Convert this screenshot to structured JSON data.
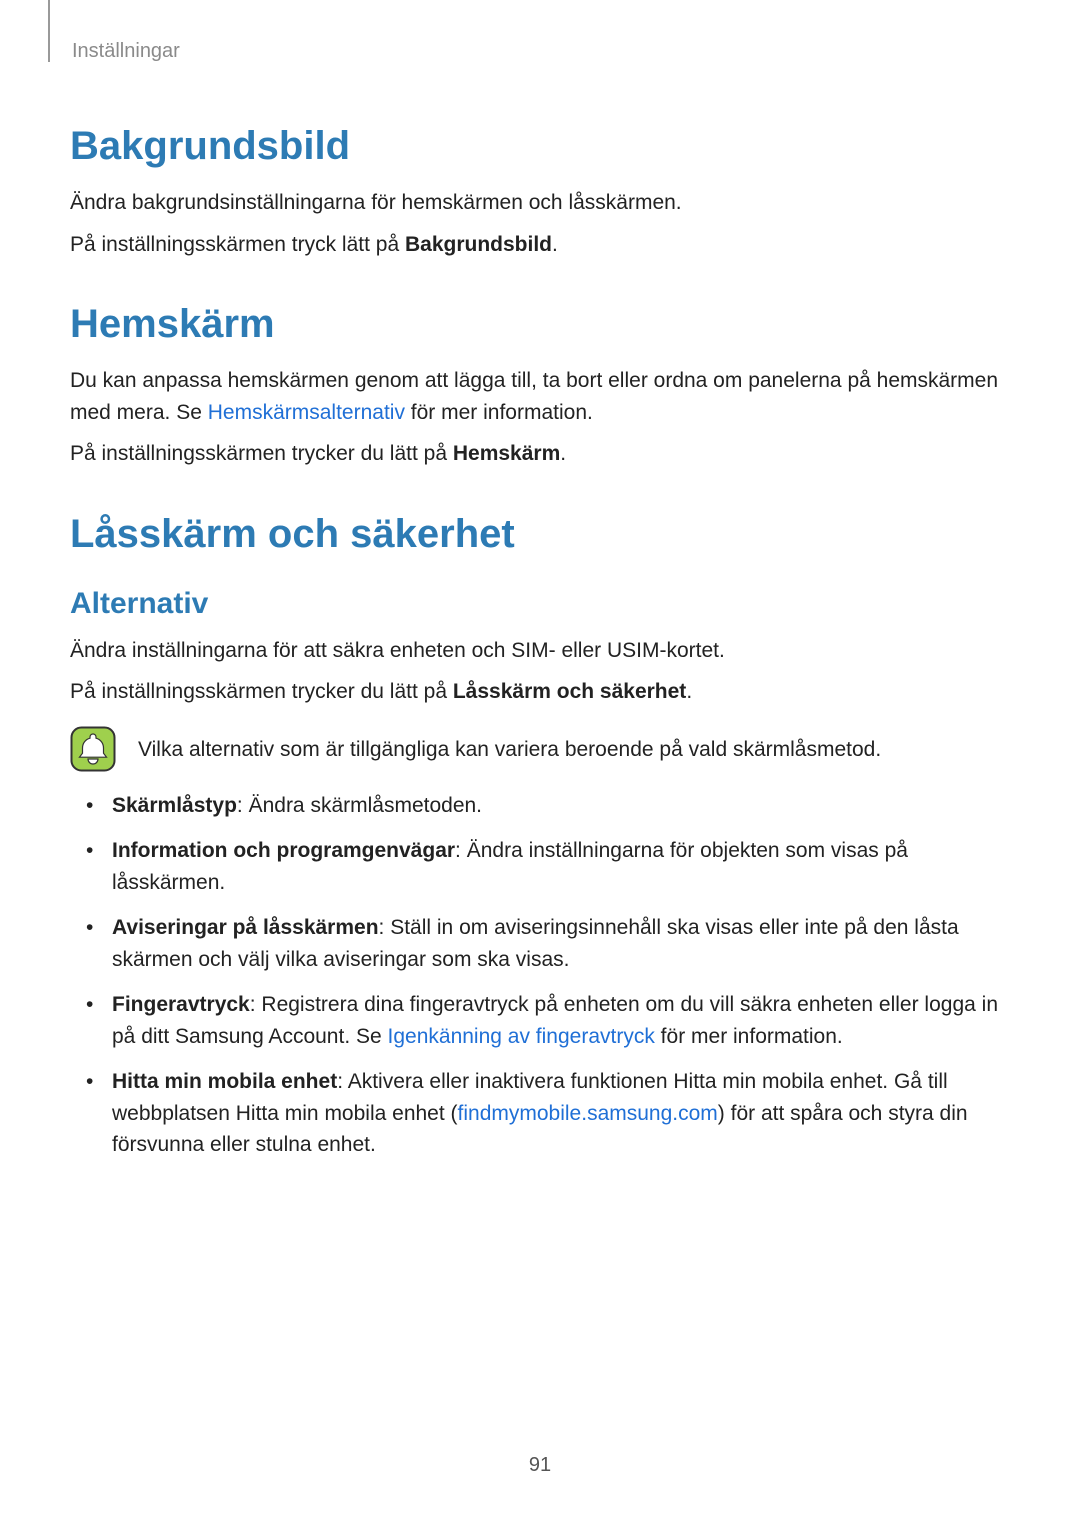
{
  "breadcrumb": "Inställningar",
  "page_number": "91",
  "sec_bakgrund": {
    "title": "Bakgrundsbild",
    "p1": "Ändra bakgrundsinställningarna för hemskärmen och låsskärmen.",
    "p2a": "På inställningsskärmen tryck lätt på ",
    "p2b": "Bakgrundsbild",
    "p2c": "."
  },
  "sec_hemskarm": {
    "title": "Hemskärm",
    "p1a": "Du kan anpassa hemskärmen genom att lägga till, ta bort eller ordna om panelerna på hemskärmen med mera. Se ",
    "p1link": "Hemskärmsalternativ",
    "p1b": " för mer information.",
    "p2a": "På inställningsskärmen trycker du lätt på ",
    "p2b": "Hemskärm",
    "p2c": "."
  },
  "sec_lasskarm": {
    "title": "Låsskärm och säkerhet",
    "sub": "Alternativ",
    "p1": "Ändra inställningarna för att säkra enheten och SIM- eller USIM-kortet.",
    "p2a": "På inställningsskärmen trycker du lätt på ",
    "p2b": "Låsskärm och säkerhet",
    "p2c": ".",
    "note": "Vilka alternativ som är tillgängliga kan variera beroende på vald skärmlåsmetod.",
    "items": [
      {
        "label": "Skärmlåstyp",
        "text": ": Ändra skärmlåsmetoden."
      },
      {
        "label": "Information och programgenvägar",
        "text": ": Ändra inställningarna för objekten som visas på låsskärmen."
      },
      {
        "label": "Aviseringar på låsskärmen",
        "text": ": Ställ in om aviseringsinnehåll ska visas eller inte på den låsta skärmen och välj vilka aviseringar som ska visas."
      },
      {
        "label": "Fingeravtryck",
        "text_a": ": Registrera dina fingeravtryck på enheten om du vill säkra enheten eller logga in på ditt Samsung Account. Se ",
        "link": "Igenkänning av fingeravtryck",
        "text_b": " för mer information."
      },
      {
        "label": "Hitta min mobila enhet",
        "text_a": ": Aktivera eller inaktivera funktionen Hitta min mobila enhet. Gå till webbplatsen Hitta min mobila enhet (",
        "link": "findmymobile.samsung.com",
        "text_b": ") för att spåra och styra din försvunna eller stulna enhet."
      }
    ]
  }
}
